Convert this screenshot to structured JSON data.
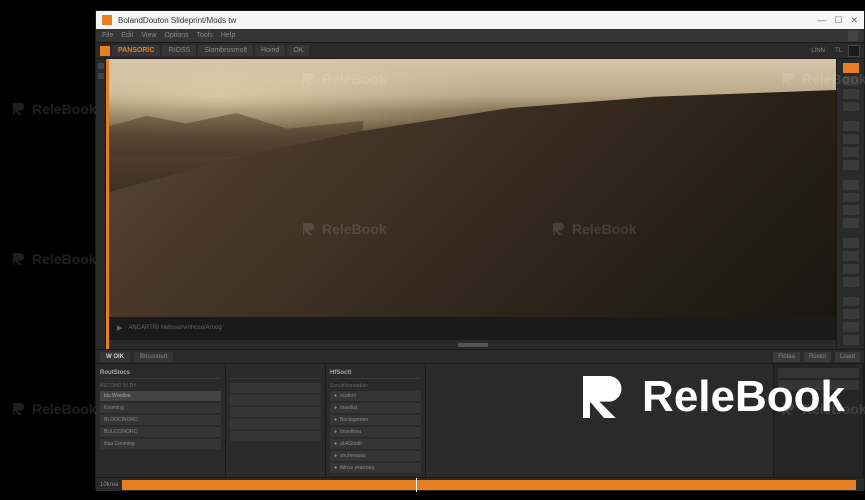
{
  "titlebar": {
    "title": "BolandDouton Slideprint/Mods tw"
  },
  "menubar": {
    "items": [
      "File",
      "Edit",
      "View",
      "Options",
      "Tools",
      "Help"
    ]
  },
  "tabbar": {
    "tab_active": "PANSORIC",
    "tab_2": "RIOSS",
    "tab_3": "Slombrosmolt",
    "tab_4": "Hoind",
    "tab_5": "OK",
    "right_label_1": "LINN",
    "right_label_2": "TL"
  },
  "viewer": {
    "status_text": "ANCARTRI Nebosorvinhoso/Aroog"
  },
  "lower_tabs": {
    "tab_1": "W OIK",
    "tab_2": "Briconourt",
    "btn_1": "Flotaa",
    "btn_2": "Rostol",
    "btn_3": "Loaot"
  },
  "panel_a": {
    "header": "RoutStocs",
    "sub": "BECOND IN TH",
    "items": [
      "blu Wredloa",
      "Kooming",
      "BLOOCINORC",
      "BULCCINORC",
      "ifiaa Cooming"
    ]
  },
  "panel_b": {
    "items": [
      "",
      "",
      "",
      "",
      "",
      ""
    ]
  },
  "panel_c": {
    "header": "HfSoctt",
    "sub": "Sonuhhioraodain",
    "items": [
      "scalnnt",
      "mastlist",
      "Boctagnmon",
      "fmsolitina",
      "abAStodb",
      "souhmasss",
      "tblnss yearroug"
    ]
  },
  "panel_d": {
    "items": []
  },
  "timeline": {
    "label": "10krea"
  },
  "watermark": {
    "brand": "ReleBook"
  }
}
